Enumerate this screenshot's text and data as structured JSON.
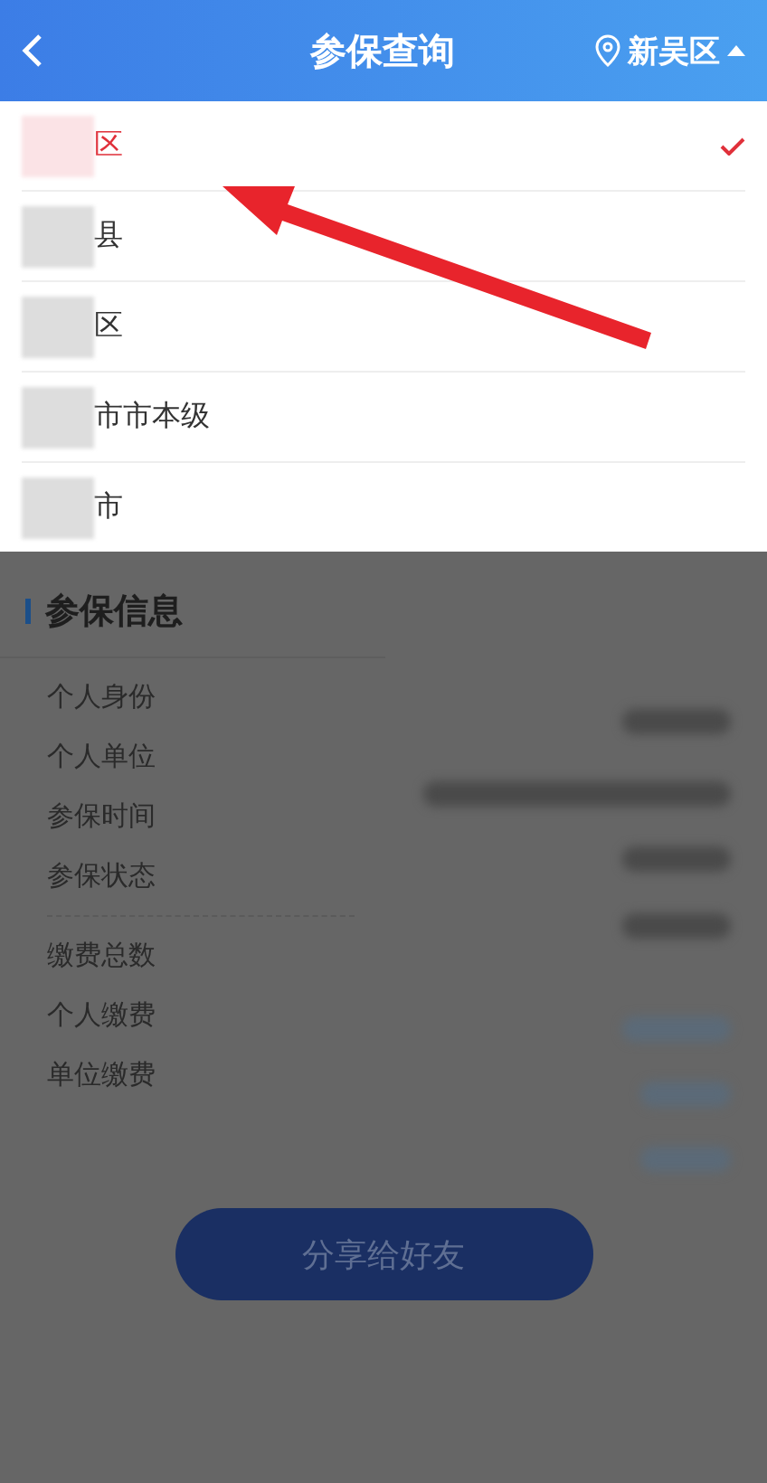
{
  "header": {
    "title": "参保查询",
    "location": "新吴区"
  },
  "regions": [
    {
      "label": "区",
      "selected": true
    },
    {
      "label": "县",
      "selected": false
    },
    {
      "label": "区",
      "selected": false
    },
    {
      "label": "市市本级",
      "selected": false
    },
    {
      "label": "市",
      "selected": false
    }
  ],
  "info": {
    "title": "参保信息",
    "groups": [
      {
        "kind": "personal",
        "labels": [
          "个人身份",
          "个人单位",
          "参保时间",
          "参保状态"
        ]
      },
      {
        "kind": "payment",
        "labels": [
          "缴费总数",
          "个人缴费",
          "单位缴费"
        ]
      }
    ]
  },
  "share_button": "分享给好友"
}
